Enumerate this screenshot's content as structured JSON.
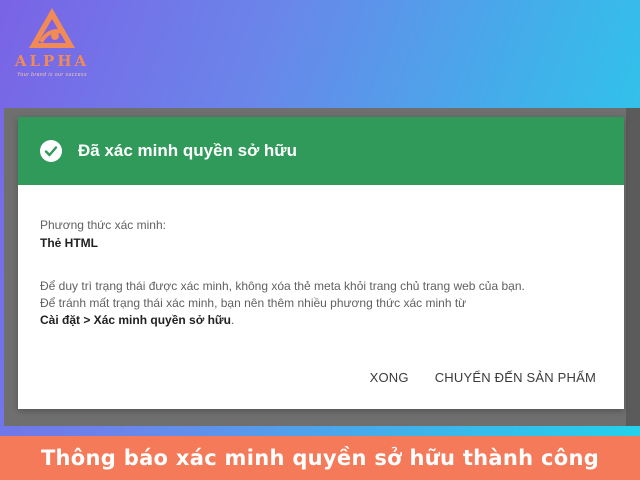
{
  "logo": {
    "name": "ALPHA",
    "tagline": "Your brand is our success",
    "color": "#f28a55"
  },
  "dialog": {
    "title": "Đã xác minh quyền sở hữu",
    "header_color": "#2f9a5a",
    "method_label": "Phương thức xác minh:",
    "method_value": "Thẻ HTML",
    "info_line1": "Để duy trì trạng thái được xác minh, không xóa thẻ meta khỏi trang chủ trang web của bạn.",
    "info_line2": "Để tránh mất trạng thái xác minh, bạn nên thêm nhiều phương thức xác minh từ",
    "info_path": "Cài đặt > Xác minh quyền sở hữu",
    "info_path_suffix": ".",
    "buttons": {
      "done": "XONG",
      "go_to_product": "CHUYỂN ĐẾN SẢN PHẨM"
    }
  },
  "banner": {
    "text": "Thông báo xác minh quyền sở hữu thành công",
    "color": "#f57a5a"
  }
}
